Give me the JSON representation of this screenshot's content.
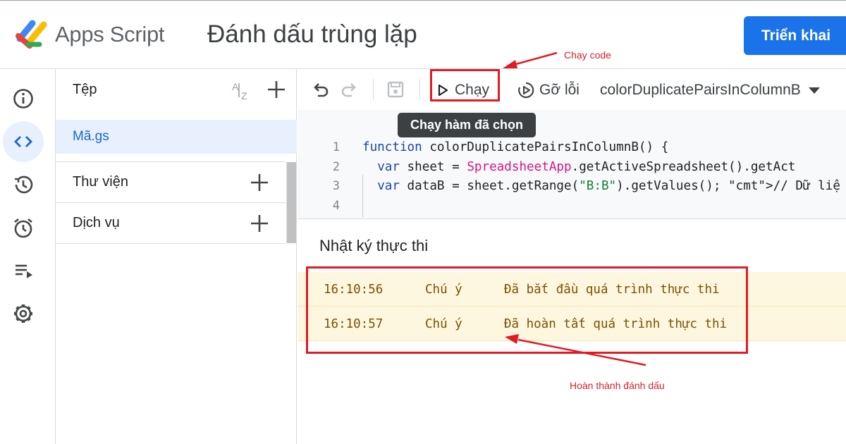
{
  "header": {
    "app_name": "Apps Script",
    "project_title": "Đánh dấu trùng lặp",
    "deploy_label": "Triển khai"
  },
  "rail": {
    "items": [
      {
        "icon": "info-icon"
      },
      {
        "icon": "code-icon",
        "active": true
      },
      {
        "icon": "history-icon"
      },
      {
        "icon": "alarm-icon"
      },
      {
        "icon": "executions-icon"
      },
      {
        "icon": "settings-icon"
      }
    ]
  },
  "files": {
    "header_label": "Tệp",
    "file_name": "Mã.gs",
    "sections": [
      "Thư viện",
      "Dịch vụ"
    ]
  },
  "toolbar": {
    "run_label": "Chạy",
    "debug_label": "Gỡ lỗi",
    "function_name": "colorDuplicatePairsInColumnB",
    "tooltip": "Chạy hàm đã chọn"
  },
  "editor": {
    "line_numbers": [
      "1",
      "2",
      "3",
      "4"
    ],
    "code_lines": [
      "function colorDuplicatePairsInColumnB() {",
      "  var sheet = SpreadsheetApp.getActiveSpreadsheet().getAct",
      "  var dataB = sheet.getRange(\"B:B\").getValues(); // Dữ liệ",
      ""
    ]
  },
  "log": {
    "title": "Nhật ký thực thi",
    "entries": [
      {
        "time": "16:10:56",
        "level": "Chú ý",
        "message": "Đã bắt đầu quá trình thực thi"
      },
      {
        "time": "16:10:57",
        "level": "Chú ý",
        "message": "Đã hoàn tất quá trình thực thi"
      }
    ]
  },
  "annotations": {
    "run_note": "Chạy code",
    "done_note": "Hoàn thành đánh dấu",
    "color": "#e01b24"
  },
  "colors": {
    "accent": "#1a73e8",
    "log_row_bg": "#fef7e0",
    "log_text": "#7a5200"
  }
}
